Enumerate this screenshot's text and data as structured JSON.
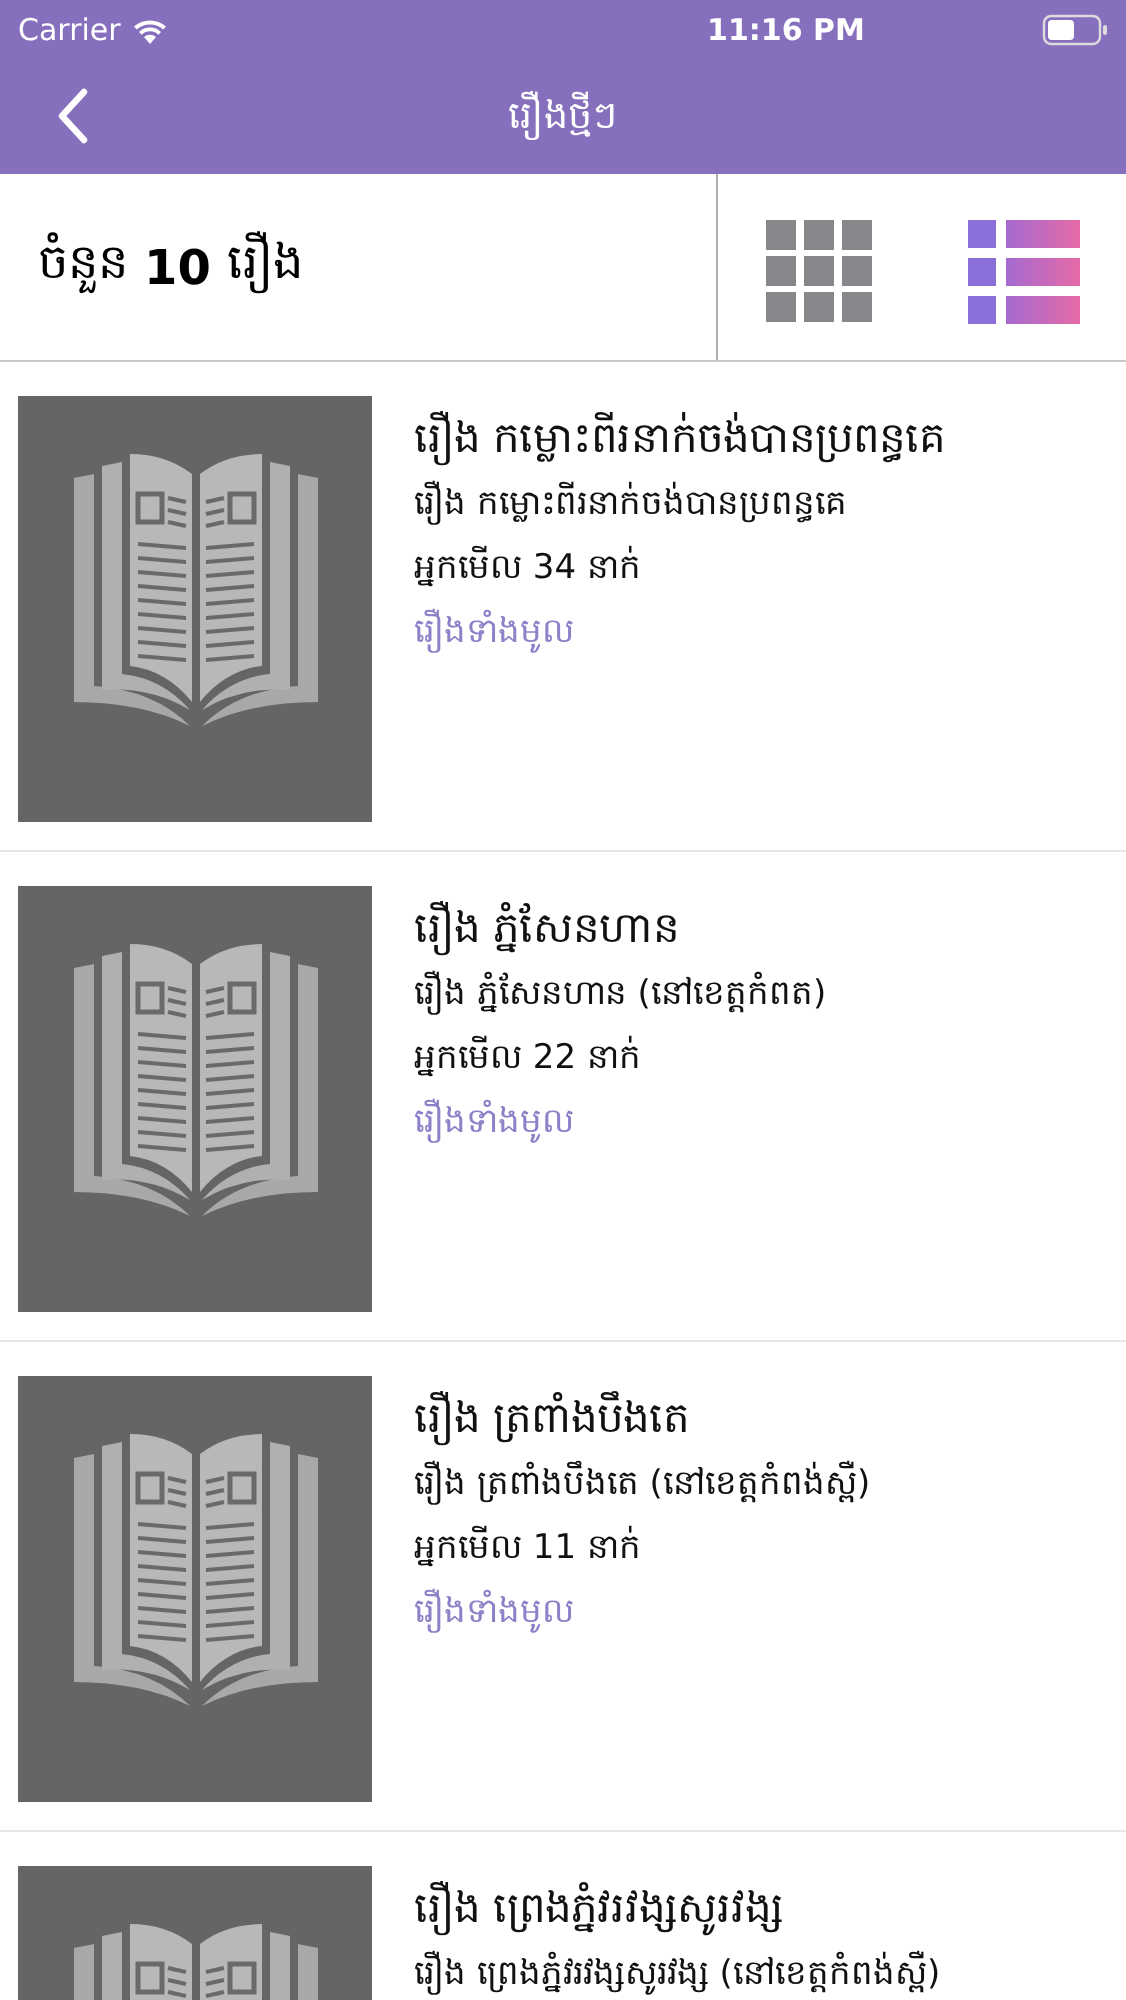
{
  "status_bar": {
    "carrier": "Carrier",
    "time": "11:16 PM"
  },
  "nav": {
    "title": "រឿងថ្មីៗ"
  },
  "summary": {
    "prefix": "ចំនួន",
    "count": "10",
    "suffix": "រឿង"
  },
  "view_options": [
    {
      "kind": "grid",
      "selected": false
    },
    {
      "kind": "list",
      "selected": true
    }
  ],
  "stories": [
    {
      "title": "រឿង កម្លោះពីរនាក់ចង់បានប្រពន្ធគេ",
      "subtitle": "រឿង កម្លោះពីរនាក់ចង់បានប្រពន្ធគេ",
      "views": "អ្នកមើល 34 នាក់",
      "link": "រឿងទាំងមូល"
    },
    {
      "title": "រឿង ភ្នំសែនហាន",
      "subtitle": "រឿង ភ្នំសែនហាន (នៅខេត្តកំពត)",
      "views": "អ្នកមើល 22 នាក់",
      "link": "រឿងទាំងមូល"
    },
    {
      "title": "រឿង ត្រពាំងបឹងតេ",
      "subtitle": "រឿង ត្រពាំងបឹងតេ (នៅខេត្តកំពង់ស្ពឺ)",
      "views": "អ្នកមើល 11 នាក់",
      "link": "រឿងទាំងមូល"
    },
    {
      "title": "រឿង ព្រេងភ្នំវរវង្សសូរវង្ស",
      "subtitle": "រឿង ព្រេងភ្នំវរវង្សសូរវង្ស (នៅខេត្តកំពង់ស្ពឺ)"
    }
  ]
}
